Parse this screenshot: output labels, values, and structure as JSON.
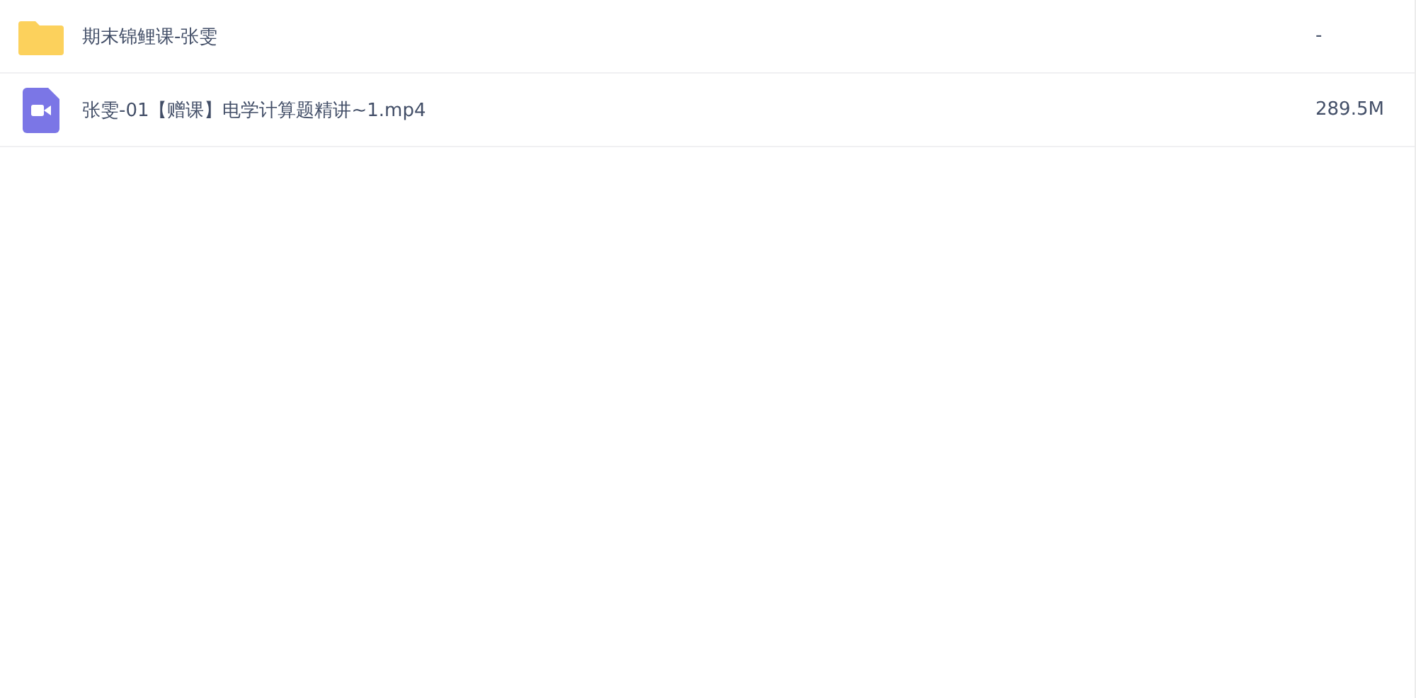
{
  "files": [
    {
      "kind": "folder",
      "name": "期末锦鲤课-张雯",
      "size": "-"
    },
    {
      "kind": "video",
      "name": "张雯-01【赠课】电学计算题精讲~1.mp4",
      "size": "289.5M"
    }
  ]
}
